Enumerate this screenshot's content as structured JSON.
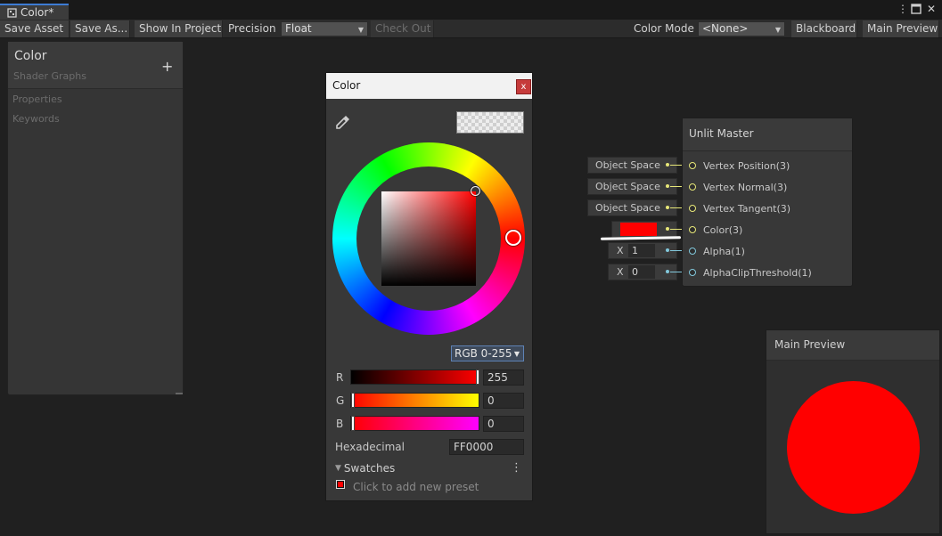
{
  "window": {
    "tab_title": "Color*",
    "menu_icon": "kebab-menu-icon",
    "maximize_icon": "maximize-icon",
    "close_icon": "close-icon"
  },
  "toolbar": {
    "save_asset": "Save Asset",
    "save_as": "Save As...",
    "show_in_project": "Show In Project",
    "precision_label": "Precision",
    "precision_value": "Float",
    "check_out": "Check Out",
    "color_mode_label": "Color Mode",
    "color_mode_value": "<None>",
    "blackboard": "Blackboard",
    "main_preview": "Main Preview"
  },
  "blackboard": {
    "title": "Color",
    "subtitle": "Shader Graphs",
    "add_icon": "plus-icon",
    "sections": [
      "Properties",
      "Keywords"
    ]
  },
  "color_picker": {
    "title": "Color",
    "close_label": "x",
    "eyedropper_icon": "eyedropper-icon",
    "mode": "RGB 0-255",
    "channels": [
      {
        "label": "R",
        "value": "255"
      },
      {
        "label": "G",
        "value": "0"
      },
      {
        "label": "B",
        "value": "0"
      }
    ],
    "hex_label": "Hexadecimal",
    "hex_value": "FF0000",
    "swatches_label": "Swatches",
    "swatches_hint": "Click to add new preset",
    "colors": {
      "current": "#ff0000"
    }
  },
  "graph": {
    "input_fields": [
      "Object Space",
      "Object Space",
      "Object Space"
    ],
    "color_input": "#ff0000",
    "vector_inputs": [
      {
        "axis": "X",
        "value": "1"
      },
      {
        "axis": "X",
        "value": "0"
      }
    ],
    "master_node": {
      "title": "Unlit Master",
      "ports": [
        {
          "label": "Vertex Position(3)",
          "color": "#e7e778"
        },
        {
          "label": "Vertex Normal(3)",
          "color": "#e7e778"
        },
        {
          "label": "Vertex Tangent(3)",
          "color": "#e7e778"
        },
        {
          "label": "Color(3)",
          "color": "#e7e778"
        },
        {
          "label": "Alpha(1)",
          "color": "#82c8dc"
        },
        {
          "label": "AlphaClipThreshold(1)",
          "color": "#82c8dc"
        }
      ]
    }
  },
  "main_preview": {
    "title": "Main Preview",
    "preview_color": "#ff0000"
  }
}
